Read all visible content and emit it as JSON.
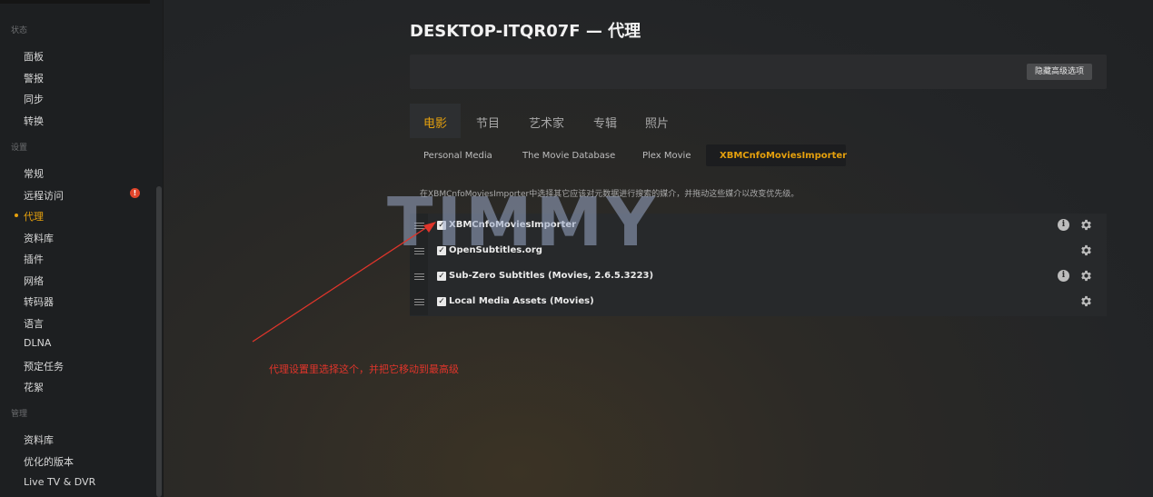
{
  "sidebar": {
    "section_status": "状态",
    "status_items": [
      {
        "label": "面板"
      },
      {
        "label": "警报"
      },
      {
        "label": "同步"
      },
      {
        "label": "转换"
      }
    ],
    "section_settings": "设置",
    "settings_items": [
      {
        "label": "常规"
      },
      {
        "label": "远程访问"
      },
      {
        "label": "代理"
      },
      {
        "label": "资料库"
      },
      {
        "label": "插件"
      },
      {
        "label": "网络"
      },
      {
        "label": "转码器"
      },
      {
        "label": "语言"
      },
      {
        "label": "DLNA"
      },
      {
        "label": "预定任务"
      },
      {
        "label": "花絮"
      }
    ],
    "section_manage": "管理",
    "manage_items": [
      {
        "label": "资料库"
      },
      {
        "label": "优化的版本"
      },
      {
        "label": "Live TV & DVR"
      }
    ],
    "alert_badge": "!",
    "active_item": "代理"
  },
  "main": {
    "title": "DESKTOP-ITQR07F — 代理",
    "advanced_button": "隐藏高级选项",
    "tabs": [
      {
        "label": "电影"
      },
      {
        "label": "节目"
      },
      {
        "label": "艺术家"
      },
      {
        "label": "专辑"
      },
      {
        "label": "照片"
      }
    ],
    "subtabs": [
      {
        "label": "Personal Media"
      },
      {
        "label": "The Movie Database"
      },
      {
        "label": "Plex Movie"
      },
      {
        "label": "XBMCnfoMoviesImporter"
      }
    ],
    "description": "在XBMCnfoMoviesImporter中选择其它应该对元数据进行搜索的媒介，并拖动这些媒介以改变优先级。",
    "agents": [
      {
        "name": "XBMCnfoMoviesImporter",
        "checked": true,
        "has_info": true
      },
      {
        "name": "OpenSubtitles.org",
        "checked": true,
        "has_info": false
      },
      {
        "name": "Sub-Zero Subtitles (Movies, 2.6.5.3223)",
        "checked": true,
        "has_info": true
      },
      {
        "name": "Local Media Assets (Movies)",
        "checked": true,
        "has_info": false
      }
    ]
  },
  "overlay": {
    "watermark": "TIMMY",
    "annotation": "代理设置里选择这个，并把它移动到最高级",
    "annotation_color": "#e0352b"
  },
  "colors": {
    "accent": "#e5a00d",
    "alert": "#e0452b"
  },
  "icons": {
    "gear": "gear-icon",
    "info": "info-icon",
    "drag": "drag-handle-icon"
  }
}
